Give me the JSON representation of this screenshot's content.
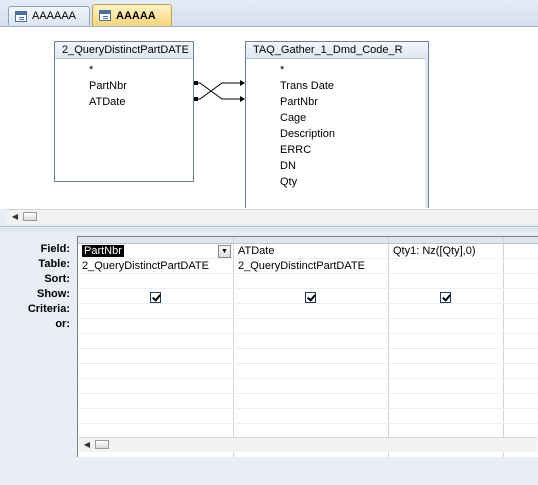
{
  "tabs": [
    {
      "label": "AAAAAA",
      "active": false
    },
    {
      "label": "AAAAA",
      "active": true
    }
  ],
  "tables": [
    {
      "title": "2_QueryDistinctPartDATE",
      "fields": [
        "*",
        "PartNbr",
        "ATDate"
      ]
    },
    {
      "title": "TAQ_Gather_1_Dmd_Code_R",
      "fields": [
        "*",
        "Trans Date",
        "PartNbr",
        "Cage",
        "Description",
        "ERRC",
        "DN",
        "Qty"
      ]
    }
  ],
  "row_labels": [
    "Field:",
    "Table:",
    "Sort:",
    "Show:",
    "Criteria:",
    "or:"
  ],
  "columns": [
    {
      "field": "PartNbr",
      "table": "2_QueryDistinctPartDATE",
      "sort": "",
      "show": true
    },
    {
      "field": "ATDate",
      "table": "2_QueryDistinctPartDATE",
      "sort": "",
      "show": true
    },
    {
      "field": "Qty1: Nz([Qty],0)",
      "table": "",
      "sort": "",
      "show": true
    }
  ],
  "icons": {
    "tab": "query-icon",
    "dropdown": "chevron-down-icon",
    "scroll_left": "arrow-left-icon"
  }
}
